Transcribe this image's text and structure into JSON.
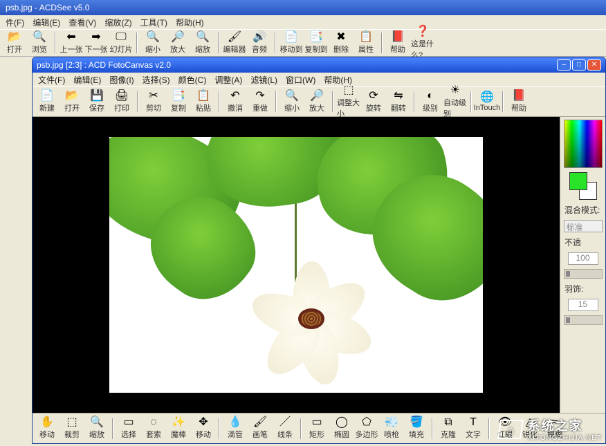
{
  "acdsee": {
    "title": "psb.jpg - ACDSee v5.0",
    "menu": [
      "件(F)",
      "编辑(E)",
      "查看(V)",
      "缩放(Z)",
      "工具(T)",
      "帮助(H)"
    ],
    "toolbar": [
      {
        "name": "open-button",
        "icon": "📂",
        "label": "打开"
      },
      {
        "name": "browse-button",
        "icon": "🔍",
        "label": "浏览"
      },
      {
        "sep": true
      },
      {
        "name": "prev-button",
        "icon": "⬅",
        "label": "上一张"
      },
      {
        "name": "next-button",
        "icon": "➡",
        "label": "下一张"
      },
      {
        "name": "slideshow-button",
        "icon": "🖵",
        "label": "幻灯片"
      },
      {
        "sep": true
      },
      {
        "name": "zoomout-button",
        "icon": "🔍",
        "label": "缩小"
      },
      {
        "name": "zoomin-button",
        "icon": "🔎",
        "label": "放大"
      },
      {
        "name": "zoom-button",
        "icon": "🔍",
        "label": "缩放"
      },
      {
        "sep": true
      },
      {
        "name": "editor-button",
        "icon": "🖌",
        "label": "编辑器"
      },
      {
        "name": "audio-button",
        "icon": "🔊",
        "label": "音频"
      },
      {
        "sep": true
      },
      {
        "name": "moveto-button",
        "icon": "📄",
        "label": "移动到"
      },
      {
        "name": "copyto-button",
        "icon": "📑",
        "label": "复制到"
      },
      {
        "name": "delete-button",
        "icon": "✖",
        "label": "删除"
      },
      {
        "name": "props-button",
        "icon": "📋",
        "label": "属性"
      },
      {
        "sep": true
      },
      {
        "name": "help-button",
        "icon": "📕",
        "label": "帮助"
      },
      {
        "name": "whatis-button",
        "icon": "❓",
        "label": "这是什么?"
      }
    ]
  },
  "fotocanvas": {
    "title": "psb.jpg [2:3] : ACD FotoCanvas v2.0",
    "menu": [
      "文件(F)",
      "编辑(E)",
      "图像(I)",
      "选择(S)",
      "颜色(C)",
      "调整(A)",
      "滤镜(L)",
      "窗口(W)",
      "帮助(H)"
    ],
    "toolbar": [
      {
        "name": "new-button",
        "icon": "📄",
        "label": "新建"
      },
      {
        "name": "open-button",
        "icon": "📂",
        "label": "打开"
      },
      {
        "name": "save-button",
        "icon": "💾",
        "label": "保存"
      },
      {
        "name": "print-button",
        "icon": "🖨",
        "label": "打印"
      },
      {
        "sep": true
      },
      {
        "name": "cut-button",
        "icon": "✂",
        "label": "剪切"
      },
      {
        "name": "copy-button",
        "icon": "📑",
        "label": "复制"
      },
      {
        "name": "paste-button",
        "icon": "📋",
        "label": "粘贴"
      },
      {
        "sep": true
      },
      {
        "name": "undo-button",
        "icon": "↶",
        "label": "撤消"
      },
      {
        "name": "redo-button",
        "icon": "↷",
        "label": "重做"
      },
      {
        "sep": true
      },
      {
        "name": "zoomout-button",
        "icon": "🔍",
        "label": "缩小"
      },
      {
        "name": "zoomin-button",
        "icon": "🔎",
        "label": "放大"
      },
      {
        "sep": true
      },
      {
        "name": "resize-button",
        "icon": "⬚",
        "label": "调整大小"
      },
      {
        "name": "rotate-button",
        "icon": "⟳",
        "label": "旋转"
      },
      {
        "name": "flip-button",
        "icon": "⇋",
        "label": "翻转"
      },
      {
        "sep": true
      },
      {
        "name": "levels-button",
        "icon": "◐",
        "label": "级别"
      },
      {
        "name": "autolevels-button",
        "icon": "☀",
        "label": "自动级别"
      },
      {
        "sep": true
      },
      {
        "name": "intouch-button",
        "icon": "🌐",
        "label": "InTouch"
      },
      {
        "sep": true
      },
      {
        "name": "help-button",
        "icon": "📕",
        "label": "帮助"
      }
    ],
    "tools": [
      {
        "name": "move-tool",
        "icon": "✋",
        "label": "移动"
      },
      {
        "name": "crop-tool",
        "icon": "⬚",
        "label": "裁剪"
      },
      {
        "name": "zoom-tool",
        "icon": "🔍",
        "label": "缩放"
      },
      {
        "sep": true
      },
      {
        "name": "select-tool",
        "icon": "▭",
        "label": "选择"
      },
      {
        "name": "lasso-tool",
        "icon": "◌",
        "label": "套索"
      },
      {
        "name": "wand-tool",
        "icon": "✨",
        "label": "魔棒"
      },
      {
        "name": "movesel-tool",
        "icon": "✥",
        "label": "移动"
      },
      {
        "sep": true
      },
      {
        "name": "eyedrop-tool",
        "icon": "💧",
        "label": "滴管"
      },
      {
        "name": "brush-tool",
        "icon": "🖌",
        "label": "画笔"
      },
      {
        "name": "line-tool",
        "icon": "／",
        "label": "线条"
      },
      {
        "sep": true
      },
      {
        "name": "rect-tool",
        "icon": "▭",
        "label": "矩形"
      },
      {
        "name": "ellipse-tool",
        "icon": "◯",
        "label": "椭圆"
      },
      {
        "name": "polygon-tool",
        "icon": "⬠",
        "label": "多边形"
      },
      {
        "name": "spray-tool",
        "icon": "💨",
        "label": "喷枪"
      },
      {
        "name": "fill-tool",
        "icon": "🪣",
        "label": "填充"
      },
      {
        "sep": true
      },
      {
        "name": "clone-tool",
        "icon": "⧉",
        "label": "克隆"
      },
      {
        "name": "text-tool",
        "icon": "T",
        "label": "文字"
      },
      {
        "sep": true
      },
      {
        "name": "redeye-tool",
        "icon": "👁",
        "label": "红眼"
      },
      {
        "name": "sharpen-tool",
        "icon": "△",
        "label": "锐化"
      },
      {
        "name": "blur-tool",
        "icon": "≈",
        "label": "模糊"
      }
    ],
    "sidepanel": {
      "blend_label": "混合模式:",
      "blend_value": "标准",
      "opacity_label": "不透",
      "opacity_value": "100",
      "feather_label": "羽饰:",
      "feather_value": "15",
      "fg_color": "#29e329",
      "bg_color": "#ffffff"
    }
  },
  "watermark": {
    "cn": "系统之家",
    "en": "XITONGZHIJIA.NET"
  }
}
